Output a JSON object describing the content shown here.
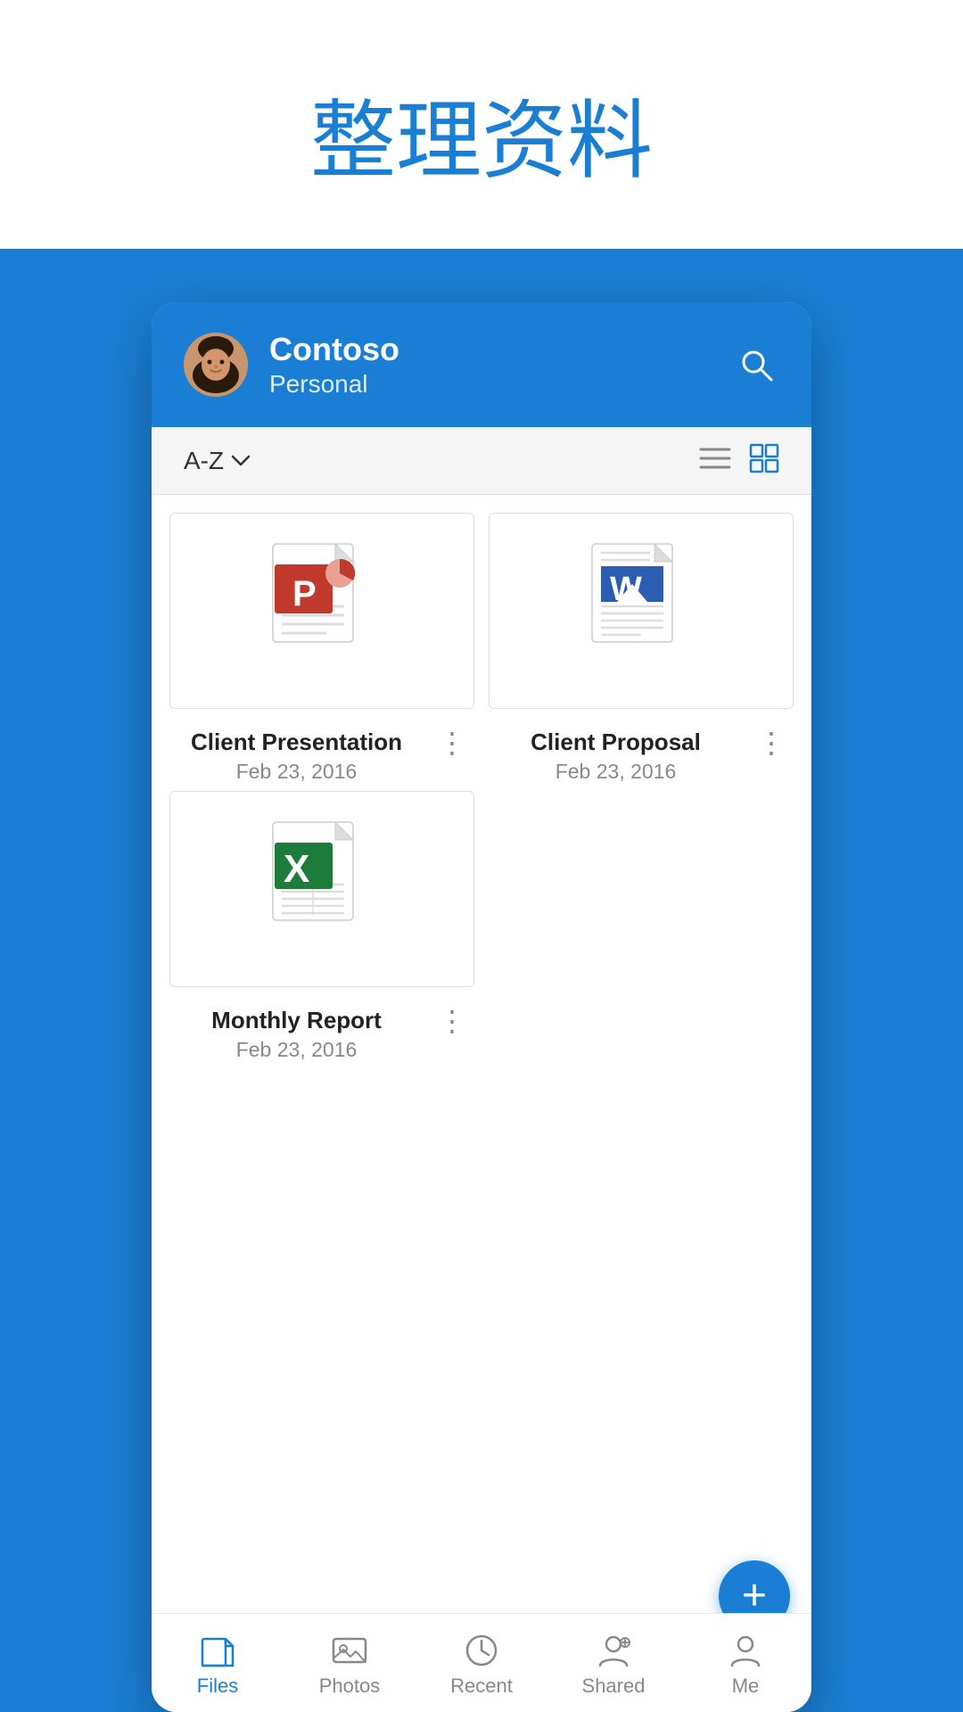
{
  "page": {
    "title": "整理资料",
    "background_color": "#1a7fd4"
  },
  "header": {
    "user_name": "Contoso",
    "user_subtitle": "Personal",
    "search_label": "search"
  },
  "toolbar": {
    "sort_label": "A-Z",
    "sort_icon": "chevron-down",
    "list_view_icon": "list",
    "grid_view_icon": "grid"
  },
  "files": [
    {
      "id": 1,
      "name": "Client Presentation",
      "date": "Feb 23, 2016",
      "type": "powerpoint",
      "icon_color": "#c0392b"
    },
    {
      "id": 2,
      "name": "Client Proposal",
      "date": "Feb 23, 2016",
      "type": "word",
      "icon_color": "#2b5eb3"
    },
    {
      "id": 3,
      "name": "Monthly Report",
      "date": "Feb 23, 2016",
      "type": "excel",
      "icon_color": "#1e7c3a"
    }
  ],
  "nav": {
    "items": [
      {
        "id": "files",
        "label": "Files",
        "active": true
      },
      {
        "id": "photos",
        "label": "Photos",
        "active": false
      },
      {
        "id": "recent",
        "label": "Recent",
        "active": false
      },
      {
        "id": "shared",
        "label": "Shared",
        "active": false
      },
      {
        "id": "me",
        "label": "Me",
        "active": false
      }
    ]
  },
  "fab": {
    "label": "+"
  }
}
